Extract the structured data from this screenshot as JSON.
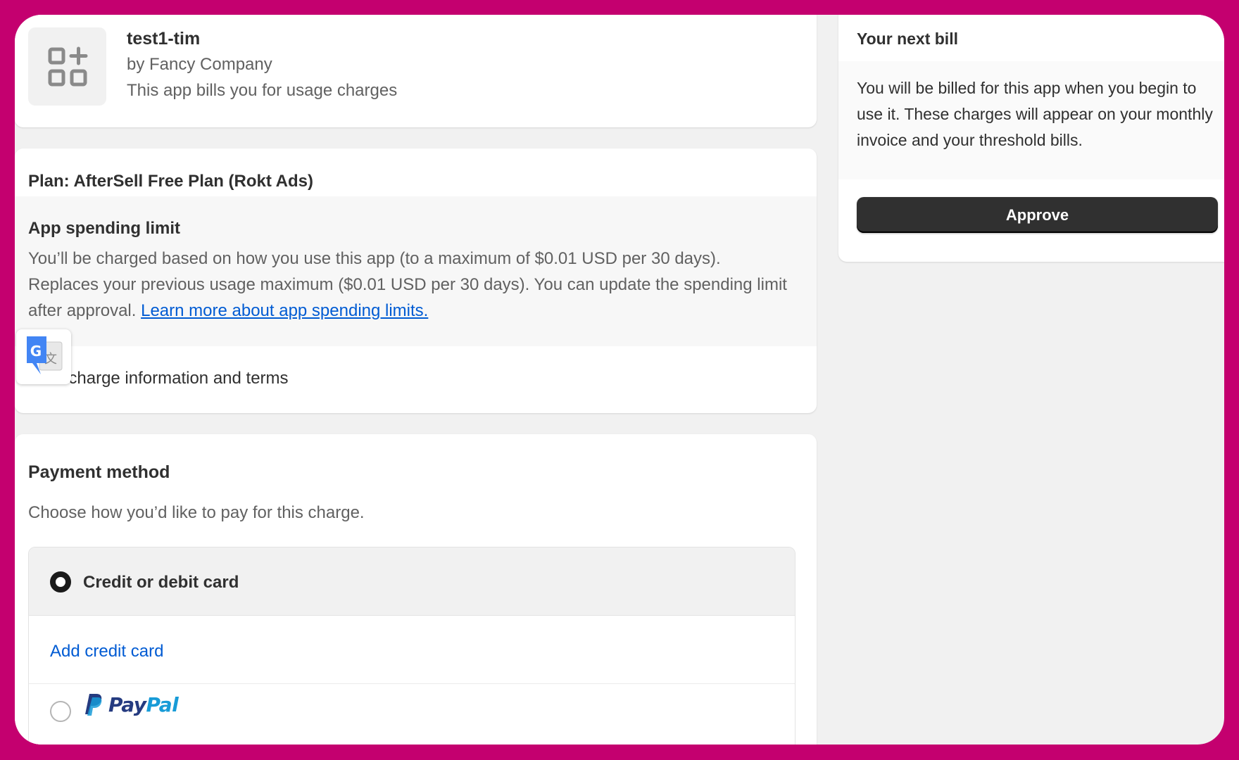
{
  "app": {
    "name": "test1-tim",
    "developer": "by Fancy Company",
    "billing_note": "This app bills you for usage charges",
    "icon": "app-grid-plus-icon"
  },
  "plan": {
    "title": "Plan: AfterSell Free Plan (Rokt Ads)",
    "spending_limit_title": "App spending limit",
    "spending_limit_text": "You’ll be charged based on how you use this app (to a maximum of $0.01 USD per 30 days). Replaces your previous usage maximum ($0.01 USD per 30 days). You can update the spending limit after approval.",
    "spending_limit_link": "Learn more about app spending limits.",
    "terms_text": "ional charge information and terms"
  },
  "translate_widget": {
    "icon": "google-translate-icon"
  },
  "payment": {
    "title": "Payment method",
    "subtitle": "Choose how you’d like to pay for this charge.",
    "options": [
      {
        "label": "Credit or debit card",
        "selected": true
      },
      {
        "label": "PayPal",
        "selected": false
      }
    ],
    "add_card_label": "Add credit card",
    "paypal_logo": {
      "part1": "Pay",
      "part2": "Pal"
    }
  },
  "bill": {
    "title": "Your next bill",
    "text": "You will be billed for this app when you begin to use it. These charges will appear on your monthly invoice and your threshold bills.",
    "approve_label": "Approve"
  },
  "colors": {
    "frame": "#c4006f",
    "link": "#005bd3",
    "primary_button": "#303030"
  }
}
